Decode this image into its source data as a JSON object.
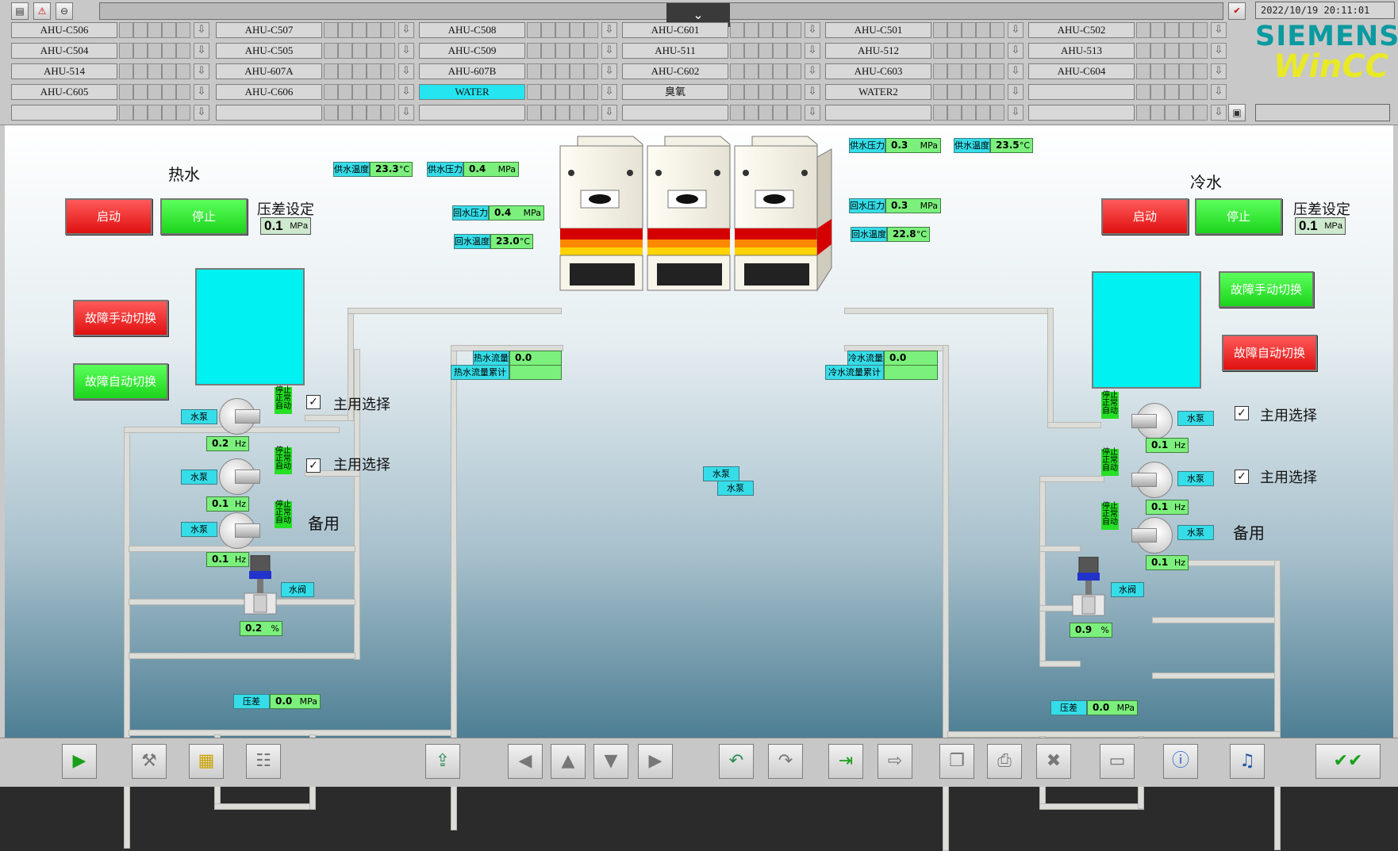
{
  "topbar": {
    "datetime": "2022/10/19 20:11:01",
    "collapse_symbol": "⌄",
    "ahu_rows": [
      [
        "AHU-C506",
        "AHU-C507",
        "AHU-C508",
        "AHU-C601",
        "AHU-C501",
        "AHU-C502"
      ],
      [
        "AHU-C504",
        "AHU-C505",
        "AHU-C509",
        "AHU-511",
        "AHU-512",
        "AHU-513"
      ],
      [
        "AHU-514",
        "AHU-607A",
        "AHU-607B",
        "AHU-C602",
        "AHU-C603",
        "AHU-C604"
      ],
      [
        "AHU-C605",
        "AHU-C606",
        "WATER",
        "臭氧",
        "WATER2",
        ""
      ],
      [
        "",
        "",
        "",
        "",
        "",
        ""
      ]
    ],
    "selected": "WATER",
    "logo_top": "SIEMENS",
    "logo_bottom": "WinCC"
  },
  "hot": {
    "title": "热水",
    "start": "启动",
    "stop": "停止",
    "dp_setpoint_label": "压差设定",
    "dp_setpoint_value": "0.1",
    "unit_mpa": "MPa",
    "fault_manual": "故障手动切换",
    "fault_auto": "故障自动切换",
    "supply_temp_label": "供水温度",
    "supply_temp": "23.3",
    "supply_pressure_label": "供水压力",
    "supply_pressure": "0.4",
    "return_pressure_label": "回水压力",
    "return_pressure": "0.4",
    "return_temp_label": "回水温度",
    "return_temp": "23.0",
    "unit_c": "°C",
    "flow_label": "热水流量",
    "flow_value": "0.0",
    "flow_total_label": "热水流量累计",
    "flow_total_value": "",
    "pumps": [
      {
        "tag": "水泵",
        "hz": "0.2",
        "status": [
          "停止",
          "正常",
          "自动"
        ],
        "main_select": true
      },
      {
        "tag": "水泵",
        "hz": "0.1",
        "status": [
          "停止",
          "正常",
          "自动"
        ],
        "main_select": true
      },
      {
        "tag": "水泵",
        "hz": "0.1",
        "status": [
          "停止",
          "正常",
          "自动"
        ],
        "main_select": false
      }
    ],
    "main_select_label": "主用选择",
    "standby_label": "备用",
    "unit_hz": "Hz",
    "valve_tag": "水阀",
    "valve_value": "0.2",
    "unit_pct": "%",
    "dp_label": "压差",
    "dp_value": "0.0"
  },
  "cold": {
    "title": "冷水",
    "start": "启动",
    "stop": "停止",
    "dp_setpoint_label": "压差设定",
    "dp_setpoint_value": "0.1",
    "fault_manual": "故障手动切换",
    "fault_auto": "故障自动切换",
    "supply_pressure_label": "供水压力",
    "supply_pressure": "0.3",
    "supply_temp_label": "供水温度",
    "supply_temp": "23.5",
    "return_pressure_label": "回水压力",
    "return_pressure": "0.3",
    "return_temp_label": "回水温度",
    "return_temp": "22.8",
    "flow_label": "冷水流量",
    "flow_value": "0.0",
    "flow_total_label": "冷水流量累计",
    "flow_total_value": "",
    "pumps": [
      {
        "tag": "水泵",
        "hz": "0.1",
        "status": [
          "停止",
          "正常",
          "自动"
        ],
        "main_select": true
      },
      {
        "tag": "水泵",
        "hz": "0.1",
        "status": [
          "停止",
          "正常",
          "自动"
        ],
        "main_select": true
      },
      {
        "tag": "水泵",
        "hz": "0.1",
        "status": [
          "停止",
          "正常",
          "自动"
        ],
        "main_select": false
      }
    ],
    "main_select_label": "主用选择",
    "standby_label": "备用",
    "valve_tag": "水阀",
    "valve_value": "0.9",
    "dp_label": "压差",
    "dp_value": "0.0"
  },
  "center_tags": [
    "水泵",
    "水泵"
  ],
  "bottombar": {
    "buttons": [
      "play-icon",
      "tools-icon",
      "notes-icon",
      "report-icon",
      "export-icon",
      "arrow-left-icon",
      "arrow-up-icon",
      "arrow-down-icon",
      "arrow-right-icon",
      "undo-icon",
      "redo-icon",
      "login-icon",
      "logout-icon",
      "copy-icon",
      "print-icon",
      "delete-icon",
      "monitor-icon",
      "info-icon",
      "sound-icon",
      "acknowledge-icon"
    ]
  }
}
